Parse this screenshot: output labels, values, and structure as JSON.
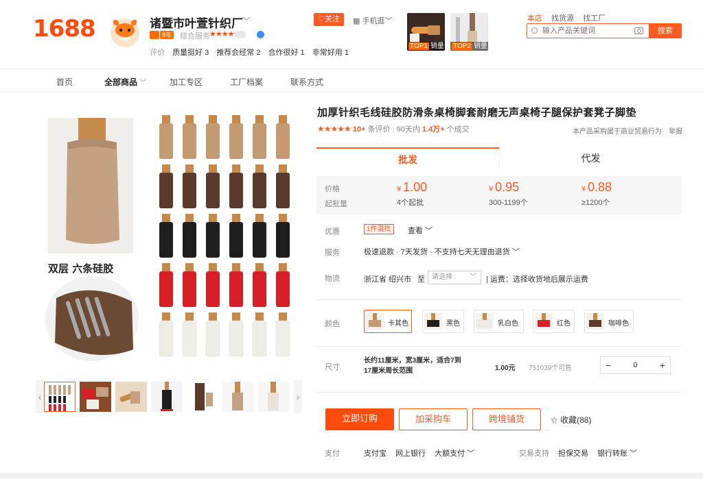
{
  "brand": {
    "logo_text": "1688",
    "accent": "#ff4c0c"
  },
  "shop": {
    "name": "诸暨市叶萱针织厂",
    "years_badge": "8年",
    "service_label": "综合服务",
    "service_stars": "★★★★★",
    "eval_label": "评价",
    "eval_tags": [
      "质量挺好 3",
      "推荐会经常 2",
      "合作很好 1",
      "非常好用 1"
    ],
    "follow_label": "关注",
    "mobile_label": "手机逛"
  },
  "top_products": [
    {
      "rank": "TOP1",
      "label": "销量"
    },
    {
      "rank": "TOP2",
      "label": "销量"
    }
  ],
  "search": {
    "scopes": [
      "本店",
      "找货源",
      "找工厂"
    ],
    "placeholder": "输入产品关键词",
    "button_label": "搜索"
  },
  "nav": {
    "items": [
      "首页",
      "全部商品",
      "加工专区",
      "工厂档案",
      "联系方式"
    ],
    "dropdown_caret": "﹀"
  },
  "gallery": {
    "caption": "双层  六条硅胶",
    "prev": "‹",
    "next": "›"
  },
  "product": {
    "title": "加厚针织毛线硅胶防滑条桌椅脚套耐磨无声桌椅子腿保护套凳子脚垫",
    "stars": "★★★★★",
    "reviews_count": "10+",
    "reviews_label": "条评价",
    "sold_prefix": "90天内",
    "sold_count": "1.4万+",
    "sold_suffix": "个成交",
    "trade_note": "本产品采购属于商业贸易行为",
    "report_label": "举报"
  },
  "mode_tabs": [
    "批发",
    "代发"
  ],
  "price": {
    "price_label": "价格",
    "qty_label": "起批量",
    "currency": "¥",
    "tiers": [
      {
        "price": "1.00",
        "qty": "4个起批"
      },
      {
        "price": "0.95",
        "qty": "300-1199个"
      },
      {
        "price": "0.88",
        "qty": "≥1200个"
      }
    ]
  },
  "promo": {
    "label": "优惠",
    "tag": "1件混批",
    "view": "查看 ﹀"
  },
  "service": {
    "label": "服务",
    "text": "极速退款 · 7天发货 · 不支持七天无理由退货 ﹀"
  },
  "logistics": {
    "label": "物流",
    "from": "浙江省 绍兴市",
    "to": "至",
    "select_placeholder": "请选择",
    "fee_text": "| 运费：选择收货地后展示运费"
  },
  "colors": {
    "label": "颜色",
    "options": [
      {
        "name": "卡其色",
        "hex": "#c49a72"
      },
      {
        "name": "黑色",
        "hex": "#1e1e1e"
      },
      {
        "name": "乳白色",
        "hex": "#efeee6"
      },
      {
        "name": "红色",
        "hex": "#d61f26"
      },
      {
        "name": "咖啡色",
        "hex": "#5a3a2a"
      }
    ]
  },
  "size": {
    "label": "尺寸",
    "desc": "长约11厘米，宽3厘米，适合7到17厘米周长范围",
    "price": "1.00元",
    "stock": "751039个可售",
    "quantity": "0",
    "minus": "−",
    "plus": "+"
  },
  "actions": {
    "buy": "立即订购",
    "cart": "加采购车",
    "cross": "跨境铺货",
    "favorite": "☆ 收藏(88)"
  },
  "payment": {
    "label": "支付",
    "methods": [
      "支付宝",
      "网上银行",
      "大额支付 ﹀"
    ],
    "trade_label": "交易支持",
    "trade_methods": [
      "担保交易",
      "银行转账 ﹀"
    ]
  }
}
